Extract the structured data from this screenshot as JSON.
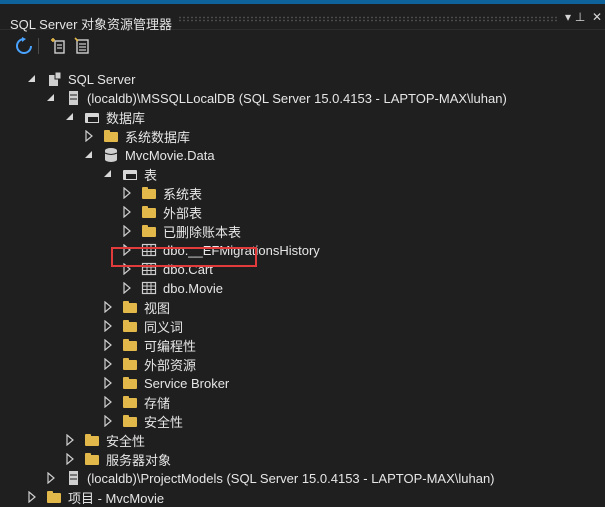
{
  "panel": {
    "title": "SQL Server 对象资源管理器",
    "pin_glyph": "▾ ⊥",
    "close_glyph": "✕"
  },
  "toolbar": {
    "refresh_icon": "refresh-icon",
    "add_server_icon": "add-sql-server-icon",
    "disconnect_icon": "disconnect-icon"
  },
  "tree": {
    "root": {
      "label": "SQL Server"
    },
    "server1": {
      "label": "(localdb)\\MSSQLLocalDB (SQL Server 15.0.4153 - LAPTOP-MAX\\luhan)"
    },
    "databases": {
      "label": "数据库"
    },
    "system_databases": {
      "label": "系统数据库"
    },
    "db": {
      "label": "MvcMovie.Data"
    },
    "tables": {
      "label": "表"
    },
    "system_tables": {
      "label": "系统表"
    },
    "external_tables": {
      "label": "外部表"
    },
    "dropped_ledger": {
      "label": "已删除账本表"
    },
    "t_ef": {
      "label": "dbo.__EFMigrationsHistory"
    },
    "t_cart": {
      "label": "dbo.Cart"
    },
    "t_movie": {
      "label": "dbo.Movie"
    },
    "views": {
      "label": "视图"
    },
    "synonyms": {
      "label": "同义词"
    },
    "programmability": {
      "label": "可编程性"
    },
    "external_resources": {
      "label": "外部资源"
    },
    "service_broker": {
      "label": "Service Broker"
    },
    "storage": {
      "label": "存储"
    },
    "db_security": {
      "label": "安全性"
    },
    "server_security": {
      "label": "安全性"
    },
    "server_objects": {
      "label": "服务器对象"
    },
    "server2": {
      "label": "(localdb)\\ProjectModels (SQL Server 15.0.4153 - LAPTOP-MAX\\luhan)"
    },
    "project": {
      "label": "项目 - MvcMovie"
    }
  },
  "colors": {
    "background": "#1f1f1f",
    "folder": "#e2b84a",
    "highlight_border": "#e23b3b",
    "accent": "#0e639c"
  }
}
